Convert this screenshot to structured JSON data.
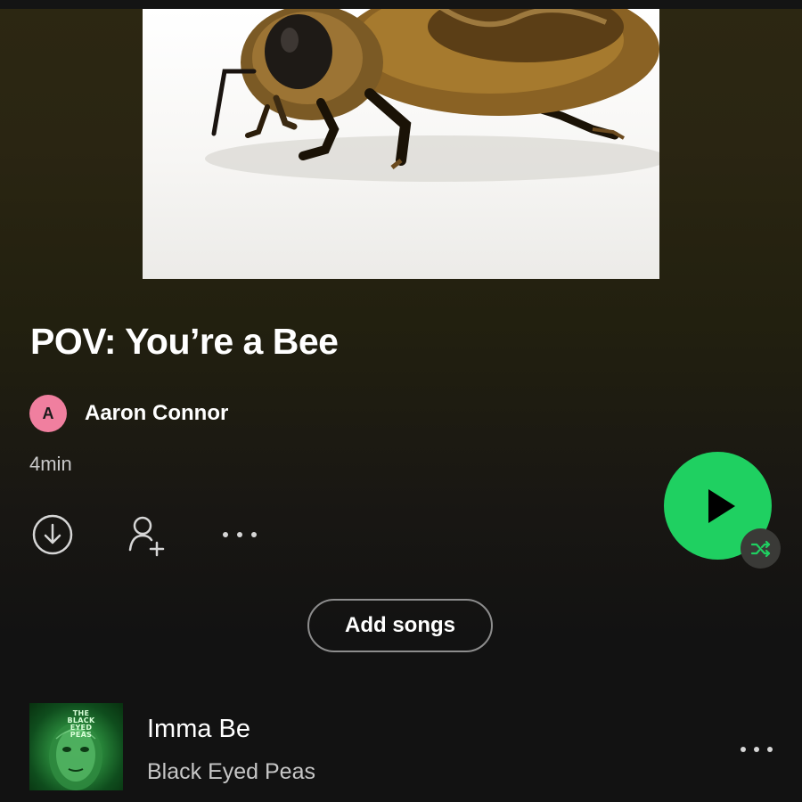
{
  "playlist": {
    "title": "POV: You’re a Bee",
    "cover_icon": "bee-photo",
    "owner": {
      "initial": "A",
      "name": "Aaron Connor",
      "avatar_color": "#f07f9f"
    },
    "duration": "4min"
  },
  "actions": {
    "download_icon": "download-circle-icon",
    "add_user_icon": "add-user-icon",
    "more_icon": "more-horizontal-icon",
    "play_icon": "play-icon",
    "shuffle_icon": "shuffle-icon",
    "add_songs_label": "Add songs"
  },
  "tracks": [
    {
      "title": "Imma Be",
      "artist": "Black Eyed Peas",
      "art_text": "THE BLACK EYED PEAS",
      "more_icon": "more-horizontal-icon"
    }
  ],
  "colors": {
    "accent": "#1fd061",
    "background": "#121212",
    "header_tint": "#2c2712"
  }
}
